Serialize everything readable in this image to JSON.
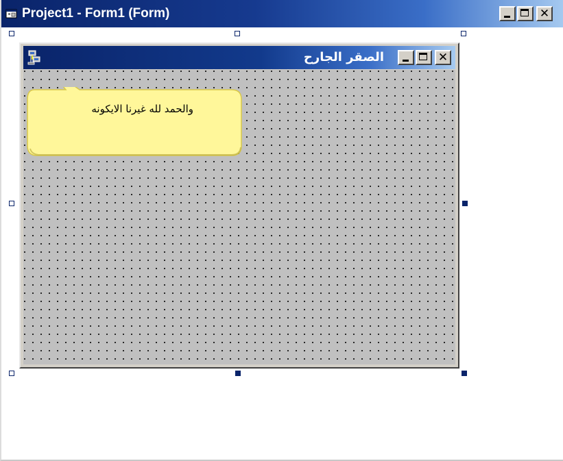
{
  "outer_window": {
    "title": "Project1 - Form1 (Form)",
    "app_icon": "form-designer-icon",
    "controls": [
      "minimize-icon",
      "maximize-icon",
      "close-icon"
    ]
  },
  "form": {
    "title": "الصقر الجارح",
    "icon": "computer-network-icon",
    "controls": [
      "minimize-icon",
      "maximize-icon",
      "close-icon"
    ],
    "close_glyph": "✕"
  },
  "callout": {
    "text": "والحمد لله غيرنا الايكونه"
  },
  "colors": {
    "titlebar_start": "#0a246a",
    "titlebar_end": "#a6caf0",
    "form_background": "#c0c0c0",
    "handle": "#0a246a",
    "callout_fill": "#fff79a"
  }
}
